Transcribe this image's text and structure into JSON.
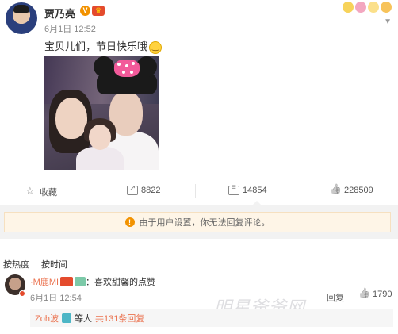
{
  "post": {
    "author": "贾乃亮",
    "verified_badge": "V",
    "time": "6月1日 12:52",
    "content": "宝贝儿们，节日快乐哦",
    "image_desc_icon": "photo-image"
  },
  "actions": {
    "favorite": "收藏",
    "share_count": "8822",
    "comment_count": "14854",
    "like_count": "228509"
  },
  "notice": {
    "text": "由于用户设置，你无法回复评论。",
    "icon": "!"
  },
  "sort": {
    "by_hot": "按热度",
    "by_time": "按时间"
  },
  "comment": {
    "user": "·M鹿MI",
    "text": "：喜欢甜馨的点赞",
    "time": "6月1日 12:54",
    "reply_label": "回复",
    "like_count": "1790",
    "watermark": "明星爸爸网"
  },
  "sub_reply": {
    "user": "Zoh波",
    "others": "等人",
    "more": "共131条回复"
  },
  "colors": {
    "accent": "#eb7350",
    "notice_bg": "#fef5e7",
    "warn": "#f29200"
  }
}
